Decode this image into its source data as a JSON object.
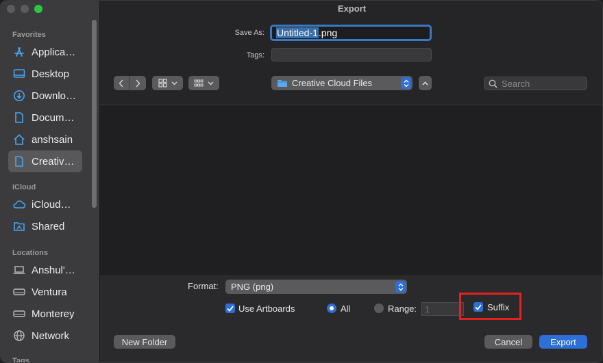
{
  "window": {
    "title": "Export"
  },
  "sidebar": {
    "sections": [
      {
        "label": "Favorites",
        "items": [
          {
            "label": "Applica…",
            "icon": "applications-icon"
          },
          {
            "label": "Desktop",
            "icon": "desktop-icon"
          },
          {
            "label": "Downlo…",
            "icon": "downloads-icon"
          },
          {
            "label": "Docum…",
            "icon": "documents-icon"
          },
          {
            "label": "anshsain",
            "icon": "home-icon"
          },
          {
            "label": "Creativ…",
            "icon": "document-icon",
            "selected": true
          }
        ]
      },
      {
        "label": "iCloud",
        "items": [
          {
            "label": "iCloud…",
            "icon": "cloud-icon"
          },
          {
            "label": "Shared",
            "icon": "shared-folder-icon"
          }
        ]
      },
      {
        "label": "Locations",
        "items": [
          {
            "label": "Anshul'…",
            "icon": "laptop-icon"
          },
          {
            "label": "Ventura",
            "icon": "drive-icon"
          },
          {
            "label": "Monterey",
            "icon": "drive-icon"
          },
          {
            "label": "Network",
            "icon": "network-icon"
          }
        ]
      },
      {
        "label": "Tags",
        "items": []
      }
    ]
  },
  "form": {
    "save_as_label": "Save As:",
    "save_as_selected": "Untitled-1",
    "save_as_rest": ".png",
    "tags_label": "Tags:",
    "location": "Creative Cloud Files",
    "search_placeholder": "Search"
  },
  "export_options": {
    "format_label": "Format:",
    "format_value": "PNG (png)",
    "use_artboards_label": "Use Artboards",
    "use_artboards_checked": true,
    "all_label": "All",
    "range_label": "Range:",
    "range_value": "1",
    "suffix_label": "Suffix",
    "suffix_checked": true
  },
  "buttons": {
    "new_folder": "New Folder",
    "cancel": "Cancel",
    "export": "Export"
  },
  "colors": {
    "accent": "#2d6fd6",
    "highlight": "#e52222",
    "traffic_green": "#2ac840"
  }
}
